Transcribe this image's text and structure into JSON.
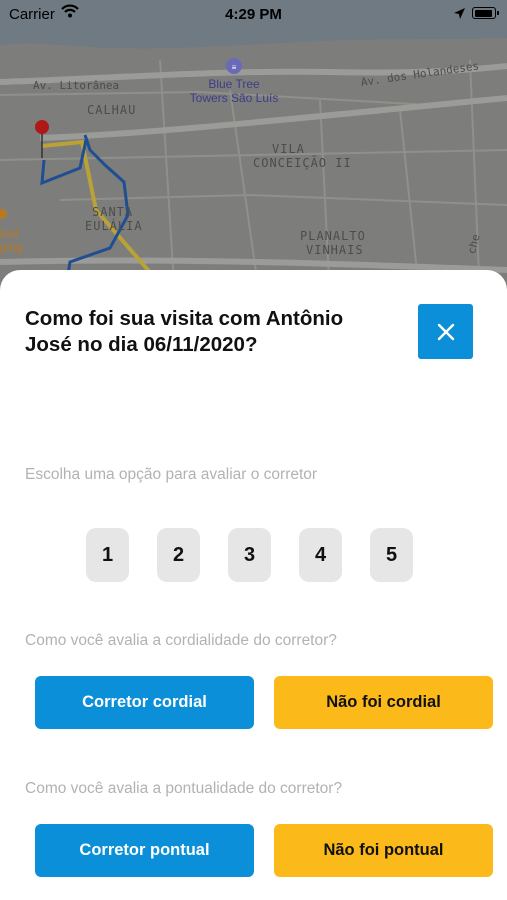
{
  "status_bar": {
    "carrier": "Carrier",
    "time": "4:29 PM",
    "battery_level": 0.95
  },
  "map": {
    "labels": {
      "litoranea": "Av. Litorânea",
      "calhau": "CALHAU",
      "holandeses": "Av. dos Holandeses",
      "vila": "VILA",
      "conceicao": "CONCEIÇÃO II",
      "santa": "SANTA",
      "eulalia": "EULÁLIA",
      "planalto": "PLANALTO",
      "vinhais": "VINHAIS",
      "poi_line1": "Blue Tree",
      "poi_line2": "Towers São Luís",
      "cut_left_1": "ical",
      "cut_left_2": "ping",
      "cut_right": "che"
    }
  },
  "sheet": {
    "title": "Como foi sua visita com Antônio José no dia 06/11/2020?",
    "rating": {
      "label": "Escolha uma opção para avaliar o corretor",
      "options": [
        "1",
        "2",
        "3",
        "4",
        "5"
      ]
    },
    "cordiality": {
      "label": "Como você avalia a cordialidade do corretor?",
      "positive": "Corretor cordial",
      "negative": "Não foi cordial"
    },
    "punctuality": {
      "label": "Como você avalia a pontualidade do corretor?",
      "positive": "Corretor pontual",
      "negative": "Não foi pontual"
    }
  },
  "colors": {
    "primary": "#0a8fd8",
    "warning": "#fbb91a",
    "muted_text": "#b2b2b2",
    "rating_bg": "#e6e6e6"
  }
}
